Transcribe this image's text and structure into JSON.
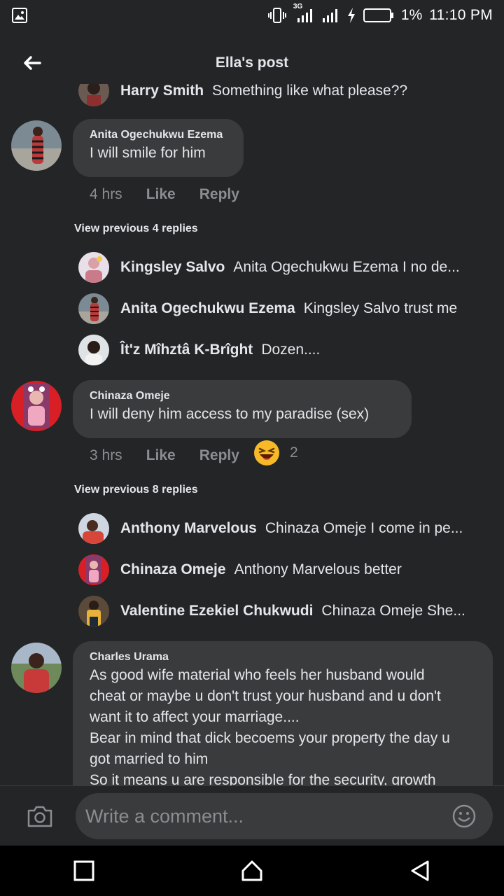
{
  "status_bar": {
    "network": "3G",
    "battery": "1%",
    "time": "11:10 PM"
  },
  "header": {
    "title": "Ella's post"
  },
  "comments": [
    {
      "author": "Anita Ogechukwu Ezema",
      "text": "I will smile for him",
      "time": "4 hrs",
      "like": "Like",
      "reply": "Reply",
      "view_previous": "View previous 4 replies",
      "replies": [
        {
          "name": "Kingsley Salvo",
          "text": "Anita Ogechukwu Ezema I no de..."
        },
        {
          "name": "Anita Ogechukwu Ezema",
          "text": "Kingsley Salvo trust me"
        },
        {
          "name": "Ît'z Mîhztâ K-Brîght",
          "text": "Dozen...."
        }
      ]
    },
    {
      "author": "Chinaza Omeje",
      "text": "I will deny him access to my paradise (sex)",
      "time": "3 hrs",
      "like": "Like",
      "reply": "Reply",
      "reaction_count": "2",
      "view_previous": "View previous 8 replies",
      "replies": [
        {
          "name": "Anthony Marvelous",
          "text": "Chinaza Omeje I come in pe..."
        },
        {
          "name": "Chinaza Omeje",
          "text": "Anthony Marvelous better"
        },
        {
          "name": "Valentine Ezekiel Chukwudi",
          "text": "Chinaza Omeje She..."
        }
      ]
    },
    {
      "author": "Charles Urama",
      "lines": [
        "As good wife material who feels her husband would",
        "cheat or maybe u don't trust your husband and u don't",
        "want it to affect your marriage....",
        "Bear in mind that dick becoems your property the day u",
        "got married to him",
        "So it means u are responsible for the security, growth"
      ]
    }
  ],
  "partial_top": {
    "name": "Harry Smith",
    "text": "Something like what please??"
  },
  "composer": {
    "placeholder": "Write a comment..."
  }
}
